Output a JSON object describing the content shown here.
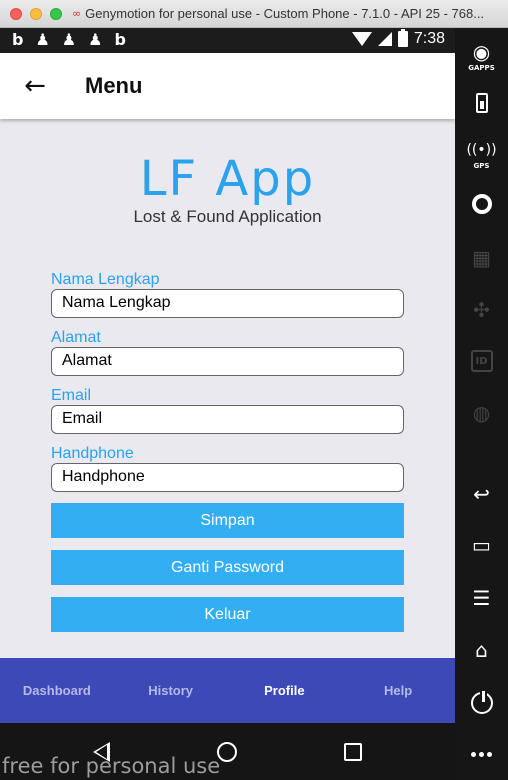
{
  "window": {
    "title": "Genymotion for personal use - Custom Phone - 7.1.0 - API 25 - 768..."
  },
  "statusbar": {
    "time": "7:38"
  },
  "appbar": {
    "title": "Menu"
  },
  "logo": {
    "title": "LF App",
    "subtitle": "Lost & Found Application"
  },
  "form": {
    "fields": [
      {
        "label": "Nama Lengkap",
        "value": "Nama Lengkap"
      },
      {
        "label": "Alamat",
        "value": "Alamat"
      },
      {
        "label": "Email",
        "value": "Email"
      },
      {
        "label": "Handphone",
        "value": "Handphone"
      }
    ],
    "buttons": {
      "save": "Simpan",
      "change_password": "Ganti Password",
      "logout": "Keluar"
    }
  },
  "bottomnav": {
    "items": [
      {
        "label": "Dashboard"
      },
      {
        "label": "History"
      },
      {
        "label": "Profile"
      },
      {
        "label": "Help"
      }
    ],
    "active": "Profile"
  },
  "sidebar": {
    "gapps_label": "GAPPS",
    "gps_label": "GPS",
    "id_label": "ID"
  },
  "watermark": "free for personal use",
  "colors": {
    "accent": "#2aa2ec",
    "button": "#33aef3",
    "bottomnav": "#3d49b6"
  }
}
